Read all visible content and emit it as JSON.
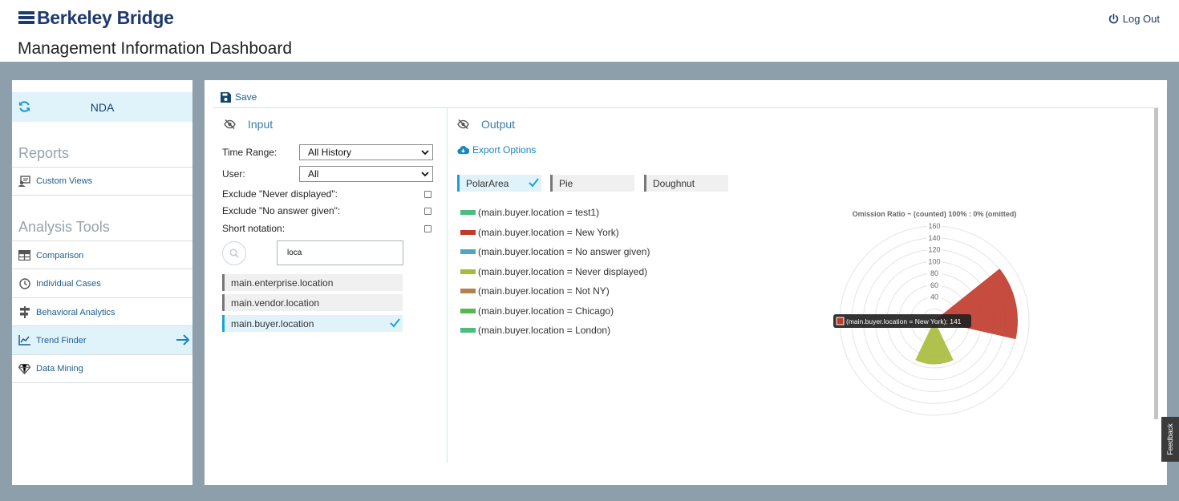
{
  "header": {
    "logo_text": "Berkeley Bridge",
    "logout_label": "Log Out",
    "page_title": "Management Information Dashboard"
  },
  "sidebar": {
    "project_name": "NDA",
    "reports_title": "Reports",
    "reports_items": [
      {
        "label": "Custom Views",
        "icon": "custom-views-icon"
      }
    ],
    "analysis_title": "Analysis Tools",
    "analysis_items": [
      {
        "label": "Comparison",
        "icon": "table-icon"
      },
      {
        "label": "Individual Cases",
        "icon": "clock-icon"
      },
      {
        "label": "Behavioral Analytics",
        "icon": "signpost-icon"
      },
      {
        "label": "Trend Finder",
        "icon": "trend-chart-icon",
        "active": true
      },
      {
        "label": "Data Mining",
        "icon": "diamond-icon"
      }
    ]
  },
  "toolbar": {
    "save_label": "Save"
  },
  "input": {
    "title": "Input",
    "time_range_label": "Time Range:",
    "time_range_value": "All History",
    "user_label": "User:",
    "user_value": "All",
    "exclude_never_label": "Exclude \"Never displayed\":",
    "exclude_never_checked": false,
    "exclude_noanswer_label": "Exclude \"No answer given\":",
    "exclude_noanswer_checked": false,
    "short_notation_label": "Short notation:",
    "short_notation_checked": false,
    "search_value": "loca",
    "variables": [
      {
        "label": "main.enterprise.location",
        "selected": false
      },
      {
        "label": "main.vendor.location",
        "selected": false
      },
      {
        "label": "main.buyer.location",
        "selected": true
      }
    ]
  },
  "output": {
    "title": "Output",
    "export_label": "Export Options",
    "chart_tabs": [
      {
        "label": "PolarArea",
        "active": true
      },
      {
        "label": "Pie",
        "active": false
      },
      {
        "label": "Doughnut",
        "active": false
      }
    ],
    "tooltip": "(main.buyer.location = New York): 141"
  },
  "feedback_label": "Feedback",
  "chart_data": {
    "type": "polarArea",
    "title": "Omission Ratio ~ (counted) 100% : 0% (omitted)",
    "r_ticks": [
      40,
      60,
      80,
      100,
      120,
      140,
      160
    ],
    "r_max": 160,
    "series": [
      {
        "name": "(main.buyer.location = test1)",
        "value": 0,
        "color": "#4dbd7f"
      },
      {
        "name": "(main.buyer.location = New York)",
        "value": 141,
        "color": "#c0392b"
      },
      {
        "name": "(main.buyer.location = No answer given)",
        "value": 0,
        "color": "#4aa8c4"
      },
      {
        "name": "(main.buyer.location = Never displayed)",
        "value": 74,
        "color": "#a9ba3a"
      },
      {
        "name": "(main.buyer.location = Not NY)",
        "value": 0,
        "color": "#b5804b"
      },
      {
        "name": "(main.buyer.location = Chicago)",
        "value": 0,
        "color": "#55b84c"
      },
      {
        "name": "(main.buyer.location = London)",
        "value": 0,
        "color": "#4dbd7f"
      }
    ]
  }
}
